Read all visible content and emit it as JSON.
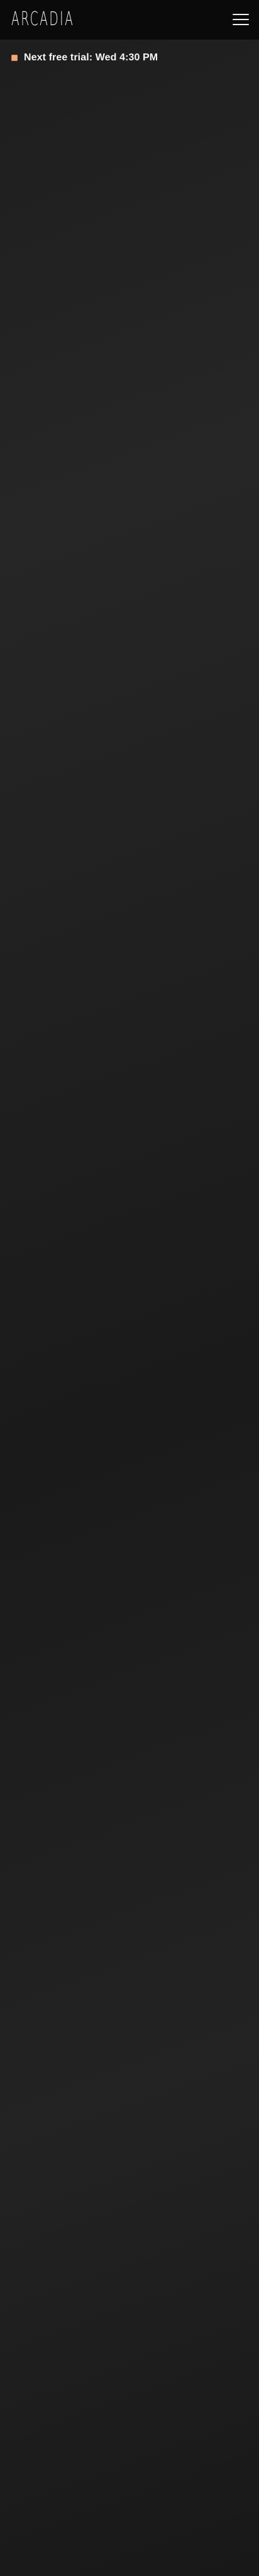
{
  "header": {
    "logo_text": "ARCADIA",
    "menu_icon": "hamburger-menu-icon"
  },
  "trial": {
    "text": "Next free trial: Wed 4:30 PM",
    "icon": "calendar-icon",
    "icon_color": "#f3a77a"
  },
  "colors": {
    "header_bg": "#0a0a0a",
    "page_bg": "#1e1e1e",
    "text": "#f5f5f5"
  }
}
